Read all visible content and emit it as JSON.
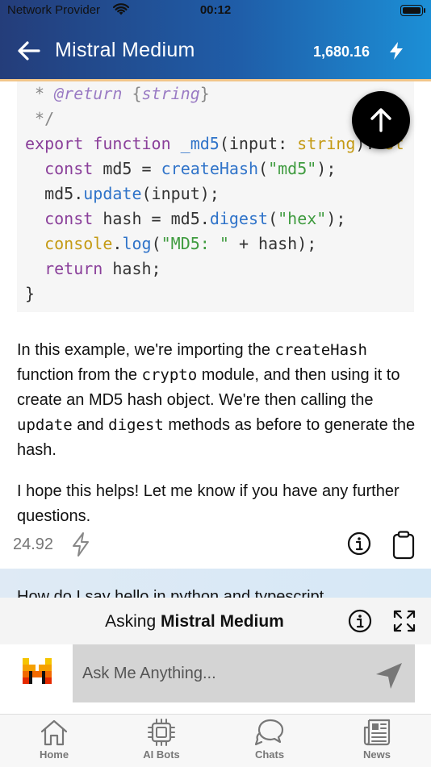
{
  "status_bar": {
    "carrier": "Network Provider",
    "time": "00:12"
  },
  "header": {
    "title": "Mistral Medium",
    "credits": "1,680.16"
  },
  "code_block": {
    "lines": [
      " * @return {string}",
      " */",
      "export function _md5(input: string): st",
      "  const md5 = createHash(\"md5\");",
      "  md5.update(input);",
      "  const hash = md5.digest(\"hex\");",
      "  console.log(\"MD5: \" + hash);",
      "  return hash;",
      "}"
    ]
  },
  "answer": {
    "p1": {
      "a": "In this example, we're importing the ",
      "code1": "createHash",
      "b": " function from the ",
      "code2": "crypto",
      "c": " module, and then using it to create an MD5 hash object. We're then calling the ",
      "code3": "update",
      "d": " and ",
      "code4": "digest",
      "e": " methods as before to generate the hash."
    },
    "p2": "I hope this helps! Let me know if you have any further questions."
  },
  "response_meta": {
    "cost": "24.92"
  },
  "next_question": "How do I say hello in python and typescript",
  "asking": {
    "prefix": "Asking ",
    "model": "Mistral Medium"
  },
  "input": {
    "placeholder": "Ask Me Anything..."
  },
  "tabs": [
    {
      "label": "Home",
      "icon": "home-icon"
    },
    {
      "label": "AI Bots",
      "icon": "chip-icon"
    },
    {
      "label": "Chats",
      "icon": "chat-bubbles-icon"
    },
    {
      "label": "News",
      "icon": "newspaper-icon"
    }
  ],
  "colors": {
    "header_gradient_start": "#243d7a",
    "header_gradient_end": "#1c8fd6",
    "header_accent": "#f2c68a",
    "code_keyword": "#8a3f9a",
    "code_function": "#2f73c9",
    "code_string": "#3f9b3f"
  }
}
